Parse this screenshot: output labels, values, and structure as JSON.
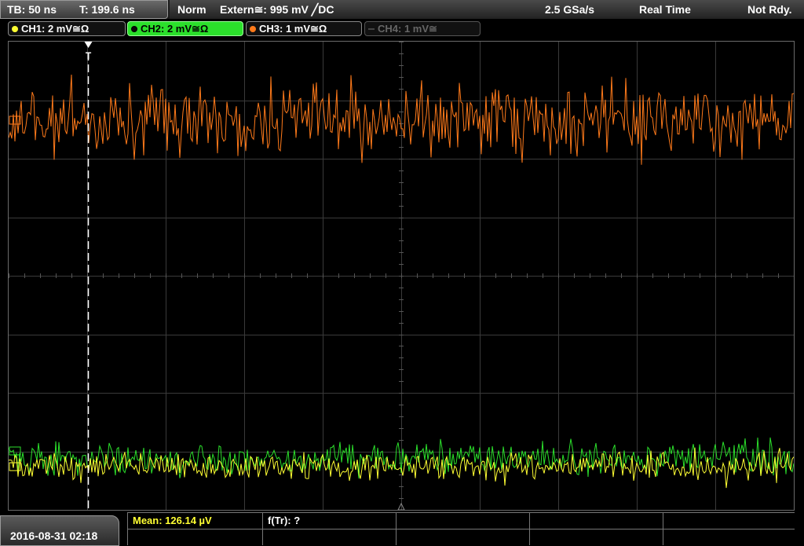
{
  "header": {
    "timebase": "TB: 50 ns",
    "trigger_time": "T: 199.6 ns",
    "mode": "Norm",
    "trigger_source": "Extern≅: 995 mV ╱DC",
    "sample_rate": "2.5 GSa/s",
    "acq_mode": "Real Time",
    "status": "Not Rdy."
  },
  "channels": [
    {
      "label": "CH1: 2 mV≅Ω",
      "color": "#ffff33",
      "state": "on"
    },
    {
      "label": "CH2: 2 mV≅Ω",
      "color": "#2be02b",
      "state": "selected"
    },
    {
      "label": "CH3: 1 mV≅Ω",
      "color": "#ff7a1a",
      "state": "on"
    },
    {
      "label": "CH4: 1 mV≅",
      "color": "#555555",
      "state": "off"
    }
  ],
  "colors": {
    "ch1": "#ffff33",
    "ch2": "#2be02b",
    "ch3": "#ff7a1a",
    "grid": "#3a3a3a",
    "trigger_marker": "#ffffff"
  },
  "trigger_marker_label": "T",
  "measurements": {
    "mean": "Mean: 126.14 µV",
    "frequency": "f(Tr): ?"
  },
  "datetime": "2016-08-31 02:18"
}
